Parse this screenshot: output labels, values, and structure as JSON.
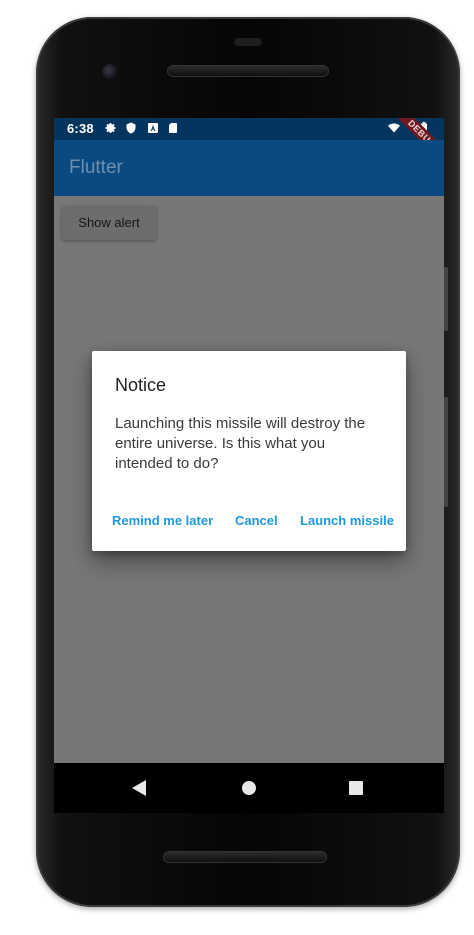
{
  "status_bar": {
    "time": "6:38",
    "icons": [
      "gear-icon",
      "shield-icon",
      "a-box-icon",
      "sd-card-icon"
    ],
    "right_icons": [
      "wifi-icon",
      "battery-icon"
    ]
  },
  "app_bar": {
    "title": "Flutter"
  },
  "debug_banner": {
    "label": "DEBUG"
  },
  "body": {
    "show_alert_label": "Show alert"
  },
  "dialog": {
    "title": "Notice",
    "message": "Launching this missile will destroy the entire universe. Is this what you intended to do?",
    "actions": [
      {
        "label": "Remind me later"
      },
      {
        "label": "Cancel"
      },
      {
        "label": "Launch missile"
      }
    ]
  },
  "nav_bar": {
    "buttons": [
      "back-icon",
      "home-icon",
      "recents-icon"
    ]
  },
  "colors": {
    "status_bar": "#04355f",
    "app_bar": "#0b4a80",
    "scrim": "#777777",
    "action_text": "#1f97dc",
    "debug_banner": "#6e1a22"
  }
}
